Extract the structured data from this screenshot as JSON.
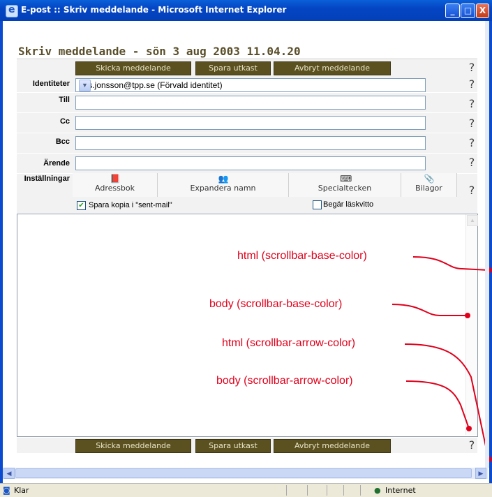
{
  "window": {
    "title": "E-post :: Skriv meddelande - Microsoft Internet Explorer",
    "min_label": "_",
    "max_label": "□",
    "close_label": "X"
  },
  "page": {
    "heading": "Skriv meddelande - sön 3 aug 2003 11.04.20"
  },
  "actions": {
    "send": "Skicka meddelande",
    "save_draft": "Spara utkast",
    "cancel": "Avbryt meddelande"
  },
  "form": {
    "identities_label": "Identiteter",
    "identity_value": "lars.jonsson@tpp.se (Förvald identitet)",
    "to_label": "Till",
    "cc_label": "Cc",
    "bcc_label": "Bcc",
    "subject_label": "Ärende",
    "settings_label": "Inställningar",
    "to_value": "",
    "cc_value": "",
    "bcc_value": "",
    "subject_value": ""
  },
  "settings": {
    "address_book": "Adressbok",
    "expand_names": "Expandera namn",
    "special_chars": "Specialtecken",
    "attachments": "Bilagor",
    "save_copy_label": "Spara kopia i \"sent-mail\"",
    "save_copy_checked": true,
    "read_receipt_label": "Begär läskvitto",
    "read_receipt_checked": false
  },
  "help_glyph": "?",
  "annotations": {
    "html_base": "html (scrollbar-base-color)",
    "body_base": "body (scrollbar-base-color)",
    "html_arrow": "html (scrollbar-arrow-color)",
    "body_arrow": "body (scrollbar-arrow-color)"
  },
  "status": {
    "left_text": "Klar",
    "zone": "Internet"
  },
  "colors": {
    "button_bg": "#5b5120",
    "annotation": "#e0001b",
    "titlebar": "#0445c4"
  }
}
